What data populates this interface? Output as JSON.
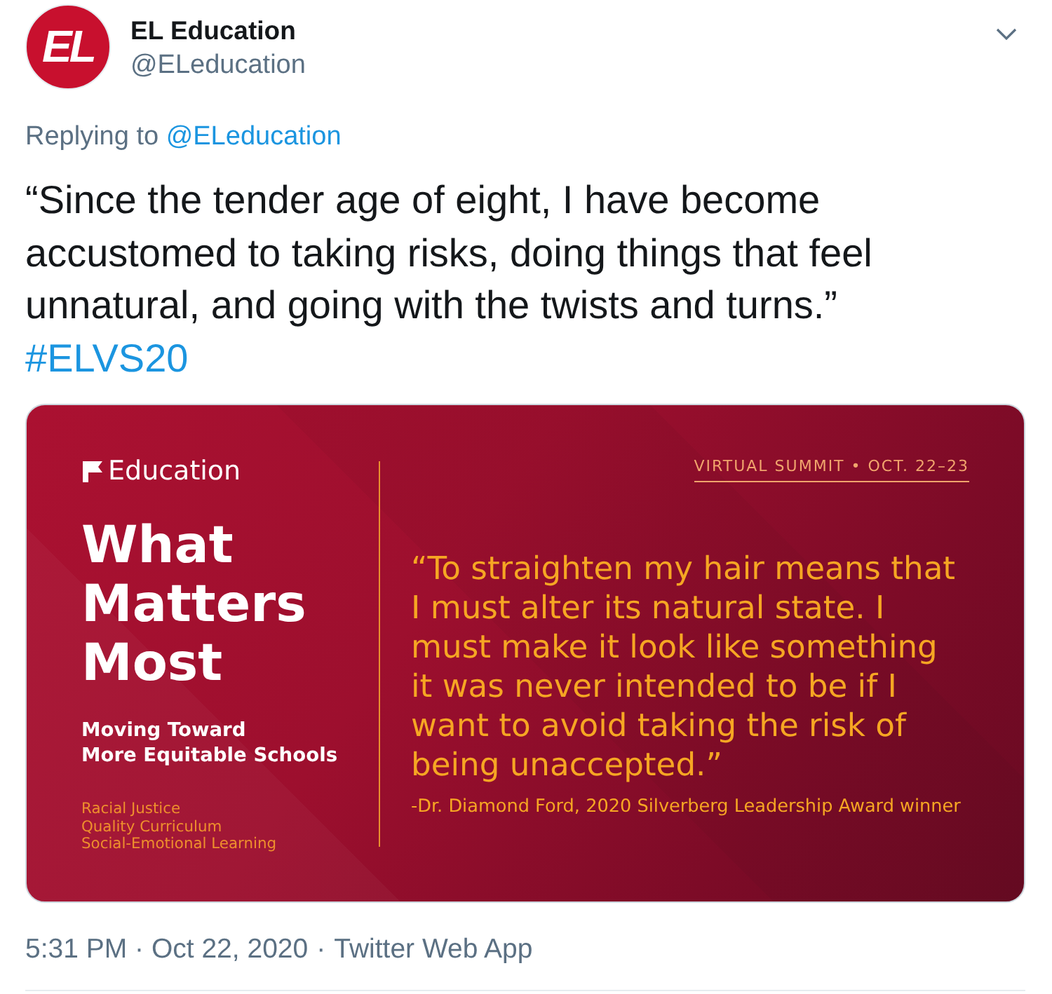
{
  "tweet": {
    "author": {
      "avatar_text": "EL",
      "name": "EL Education",
      "handle": "@ELeducation"
    },
    "reply_to": {
      "label": "Replying to",
      "handle": "@ELeducation"
    },
    "text": "“Since the tender age of eight, I have become\naccustomed to taking risks, doing things that feel\nunnatural, and going with the twists and turns.”",
    "hashtag": "#ELVS20",
    "media": {
      "logo_text": "Education",
      "title": "What Matters Most",
      "subtitle": "Moving Toward\nMore Equitable Schools",
      "topics": [
        "Racial Justice",
        "Quality Curriculum",
        "Social-Emotional Learning"
      ],
      "event": "VIRTUAL SUMMIT • OCT. 22–23",
      "quote": "“To straighten my hair means that\nI must alter its natural state. I\nmust make it look like something\nit was never intended to be if I\nwant to avoid taking the risk of\nbeing unaccepted.”",
      "attribution": "-Dr. Diamond Ford, 2020 Silverberg Leadership Award winner"
    },
    "footer": {
      "timestamp": "5:31 PM · Oct 22, 2020",
      "separator": "·",
      "source": "Twitter Web App"
    }
  }
}
